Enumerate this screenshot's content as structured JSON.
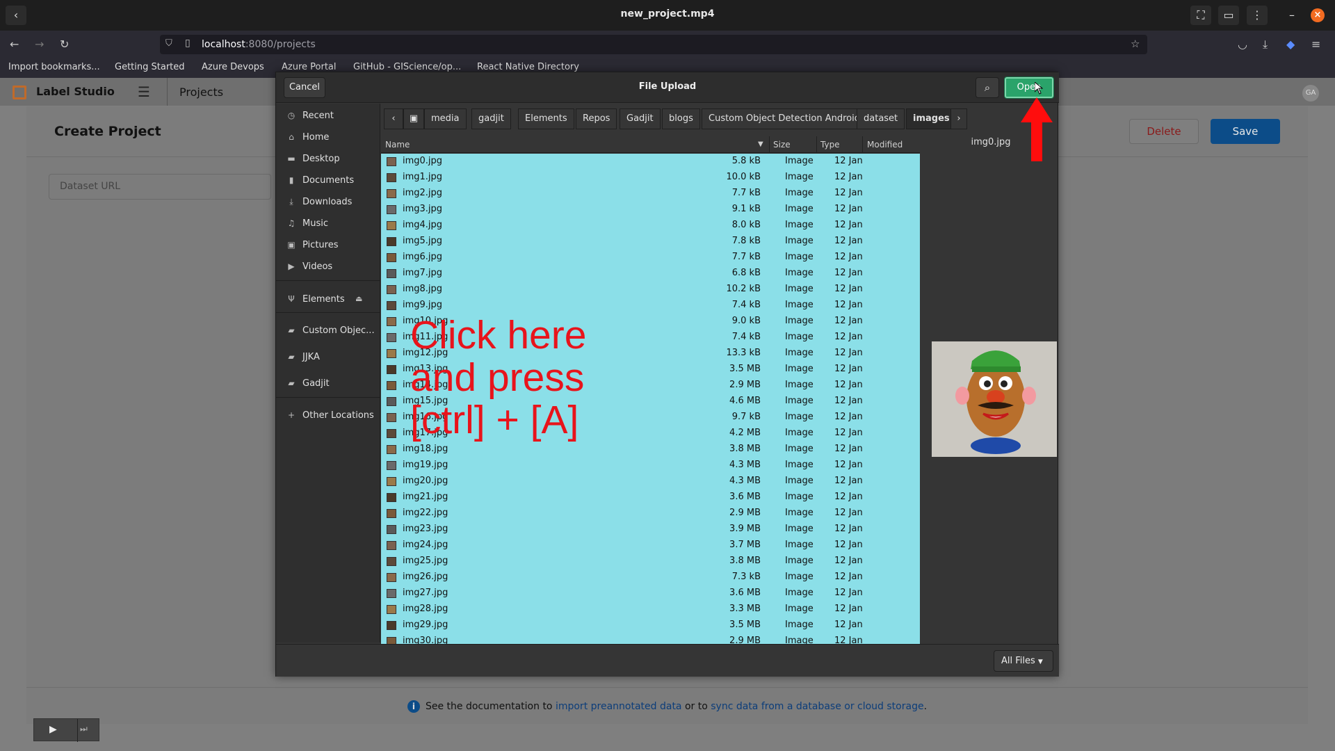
{
  "window": {
    "title": "new_project.mp4"
  },
  "browser": {
    "url_host": "localhost",
    "url_path": ":8080/projects",
    "bookmarks": [
      "Import bookmarks...",
      "Getting Started",
      "Azure Devops",
      "Azure Portal",
      "GitHub - GIScience/op...",
      "React Native Directory"
    ]
  },
  "app": {
    "brand": "Label Studio",
    "nav_projects": "Projects",
    "avatar": "GA"
  },
  "create_project": {
    "title": "Create Project",
    "delete_label": "Delete",
    "save_label": "Save",
    "dataset_url_placeholder": "Dataset URL",
    "footer_prefix": "See the documentation to",
    "footer_link1": "import preannotated data",
    "footer_mid": "or to",
    "footer_link2": "sync data from a database or cloud storage",
    "footer_suffix": "."
  },
  "dialog": {
    "title": "File Upload",
    "cancel_label": "Cancel",
    "open_label": "Open",
    "filter_label": "All Files",
    "sidebar": [
      {
        "label": "Recent",
        "icon": "clock-icon"
      },
      {
        "label": "Home",
        "icon": "home-icon"
      },
      {
        "label": "Desktop",
        "icon": "desktop-icon"
      },
      {
        "label": "Documents",
        "icon": "document-icon"
      },
      {
        "label": "Downloads",
        "icon": "download-icon"
      },
      {
        "label": "Music",
        "icon": "music-icon"
      },
      {
        "label": "Pictures",
        "icon": "picture-icon"
      },
      {
        "label": "Videos",
        "icon": "video-icon"
      },
      {
        "label": "Elements",
        "icon": "usb-icon"
      },
      {
        "label": "Custom Objec...",
        "icon": "folder-icon"
      },
      {
        "label": "JJKA",
        "icon": "folder-icon"
      },
      {
        "label": "Gadjit",
        "icon": "folder-icon"
      },
      {
        "label": "Other Locations",
        "icon": "plus-icon"
      }
    ],
    "path": [
      "media",
      "gadjit",
      "Elements",
      "Repos",
      "Gadjit",
      "blogs",
      "Custom Object Detection Android",
      "dataset",
      "images"
    ],
    "columns": {
      "name": "Name",
      "size": "Size",
      "type": "Type",
      "modified": "Modified"
    },
    "files": [
      {
        "name": "img0.jpg",
        "size": "5.8 kB"
      },
      {
        "name": "img1.jpg",
        "size": "10.0 kB"
      },
      {
        "name": "img2.jpg",
        "size": "7.7 kB"
      },
      {
        "name": "img3.jpg",
        "size": "9.1 kB"
      },
      {
        "name": "img4.jpg",
        "size": "8.0 kB"
      },
      {
        "name": "img5.jpg",
        "size": "7.8 kB"
      },
      {
        "name": "img6.jpg",
        "size": "7.7 kB"
      },
      {
        "name": "img7.jpg",
        "size": "6.8 kB"
      },
      {
        "name": "img8.jpg",
        "size": "10.2 kB"
      },
      {
        "name": "img9.jpg",
        "size": "7.4 kB"
      },
      {
        "name": "img10.jpg",
        "size": "9.0 kB"
      },
      {
        "name": "img11.jpg",
        "size": "7.4 kB"
      },
      {
        "name": "img12.jpg",
        "size": "13.3 kB"
      },
      {
        "name": "img13.jpg",
        "size": "3.5 MB"
      },
      {
        "name": "img14.jpg",
        "size": "2.9 MB"
      },
      {
        "name": "img15.jpg",
        "size": "4.6 MB"
      },
      {
        "name": "img16.jpg",
        "size": "9.7 kB"
      },
      {
        "name": "img17.jpg",
        "size": "4.2 MB"
      },
      {
        "name": "img18.jpg",
        "size": "3.8 MB"
      },
      {
        "name": "img19.jpg",
        "size": "4.3 MB"
      },
      {
        "name": "img20.jpg",
        "size": "4.3 MB"
      },
      {
        "name": "img21.jpg",
        "size": "3.6 MB"
      },
      {
        "name": "img22.jpg",
        "size": "2.9 MB"
      },
      {
        "name": "img23.jpg",
        "size": "3.9 MB"
      },
      {
        "name": "img24.jpg",
        "size": "3.7 MB"
      },
      {
        "name": "img25.jpg",
        "size": "3.8 MB"
      },
      {
        "name": "img26.jpg",
        "size": "7.3 kB"
      },
      {
        "name": "img27.jpg",
        "size": "3.6 MB"
      },
      {
        "name": "img28.jpg",
        "size": "3.3 MB"
      },
      {
        "name": "img29.jpg",
        "size": "3.5 MB"
      },
      {
        "name": "img30.jpg",
        "size": "2.9 MB"
      }
    ],
    "file_type": "Image",
    "file_modified": "12 Jan",
    "preview_name": "img0.jpg",
    "overlay_lines": [
      "Click here",
      "and press",
      "[ctrl] + [A]"
    ]
  },
  "colors": {
    "selection": "#8bdfe8",
    "annotation_red": "#e8141b",
    "open_button": "#2aa36a"
  }
}
